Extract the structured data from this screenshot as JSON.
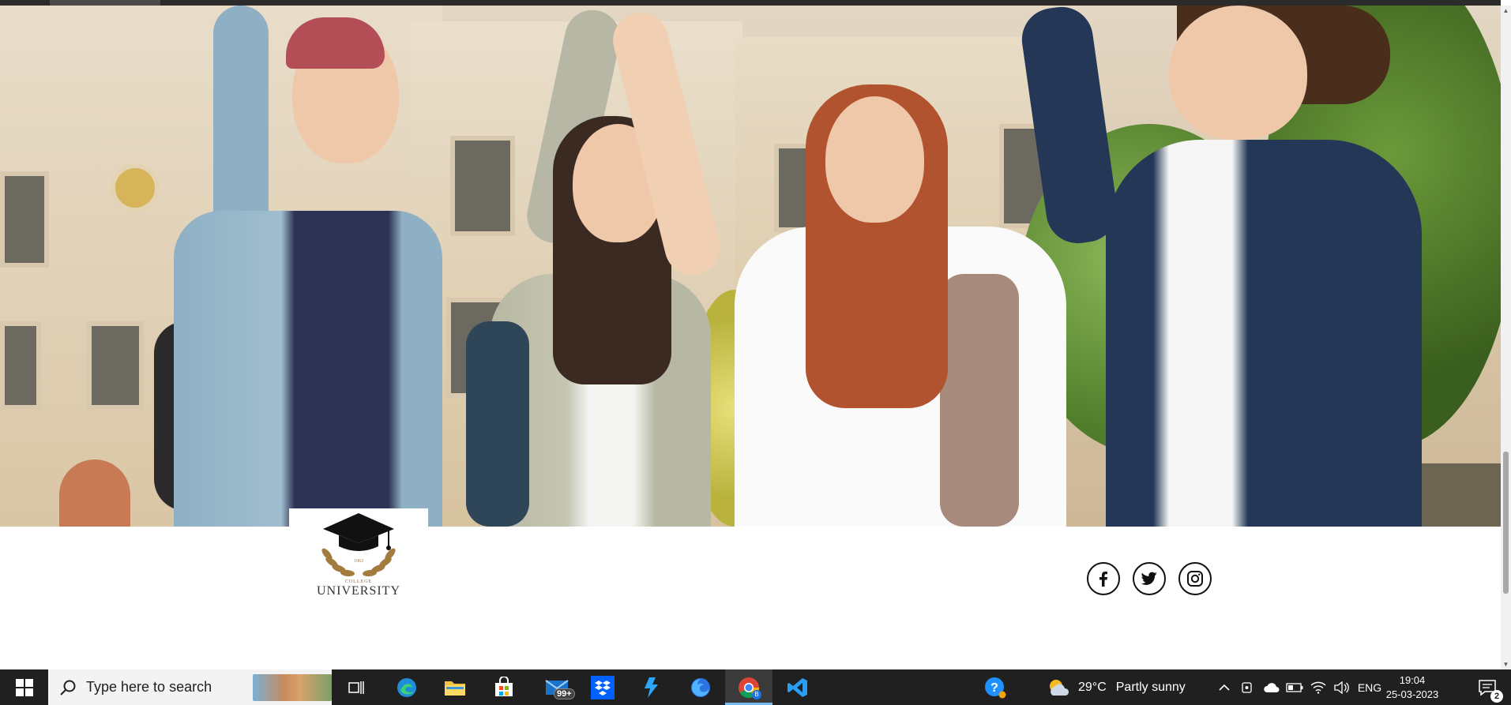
{
  "logo": {
    "year": "1963",
    "subtitle": "COLLEGE",
    "name": "UNIVERSITY"
  },
  "social": [
    "facebook-icon",
    "twitter-icon",
    "instagram-icon"
  ],
  "taskbar": {
    "search_placeholder": "Type here to search",
    "mail_badge": "99+",
    "chrome_badge": "B",
    "weather_temp": "29°C",
    "weather_desc": "Partly sunny",
    "language": "ENG",
    "time": "19:04",
    "date": "25-03-2023",
    "notification_count": "2"
  },
  "colors": {
    "taskbar": "#202020",
    "accent": "#0078d4",
    "logo_gold": "#a27b3f"
  }
}
